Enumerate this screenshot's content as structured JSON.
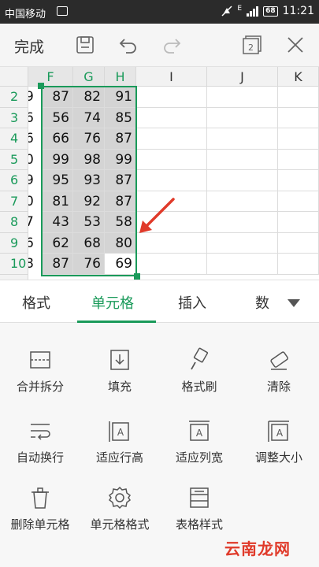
{
  "status_bar": {
    "carrier": "中国移动",
    "network": "E",
    "battery": "68",
    "time": "11:21"
  },
  "toolbar": {
    "done_label": "完成"
  },
  "sheet": {
    "columns": [
      "F",
      "G",
      "H",
      "I",
      "J",
      "K"
    ],
    "rows": [
      "2",
      "3",
      "4",
      "5",
      "6",
      "7",
      "8",
      "9",
      "10"
    ],
    "clipped_e": [
      "9",
      "6",
      "6",
      "0",
      "9",
      "0",
      "7",
      "6",
      "8"
    ],
    "values": [
      [
        "87",
        "82",
        "91"
      ],
      [
        "56",
        "74",
        "85"
      ],
      [
        "66",
        "76",
        "87"
      ],
      [
        "99",
        "98",
        "99"
      ],
      [
        "95",
        "93",
        "87"
      ],
      [
        "81",
        "92",
        "87"
      ],
      [
        "43",
        "53",
        "58"
      ],
      [
        "62",
        "68",
        "80"
      ],
      [
        "87",
        "76",
        "69"
      ]
    ]
  },
  "tabs": [
    "格式",
    "单元格",
    "插入",
    "数"
  ],
  "active_tab": "单元格",
  "tools": [
    {
      "label": "合并拆分",
      "icon": "merge-split-icon"
    },
    {
      "label": "填充",
      "icon": "fill-icon"
    },
    {
      "label": "格式刷",
      "icon": "format-painter-icon"
    },
    {
      "label": "清除",
      "icon": "eraser-icon"
    },
    {
      "label": "自动换行",
      "icon": "wrap-text-icon"
    },
    {
      "label": "适应行高",
      "icon": "fit-row-height-icon"
    },
    {
      "label": "适应列宽",
      "icon": "fit-column-width-icon"
    },
    {
      "label": "调整大小",
      "icon": "resize-icon"
    },
    {
      "label": "删除单元格",
      "icon": "delete-cell-icon"
    },
    {
      "label": "单元格格式",
      "icon": "gear-icon"
    },
    {
      "label": "表格样式",
      "icon": "table-style-icon"
    }
  ],
  "watermark": "云南龙网",
  "colors": {
    "accent": "#1a9a5a",
    "selection": "#d4d4d4",
    "arrow": "#e03a2a"
  }
}
